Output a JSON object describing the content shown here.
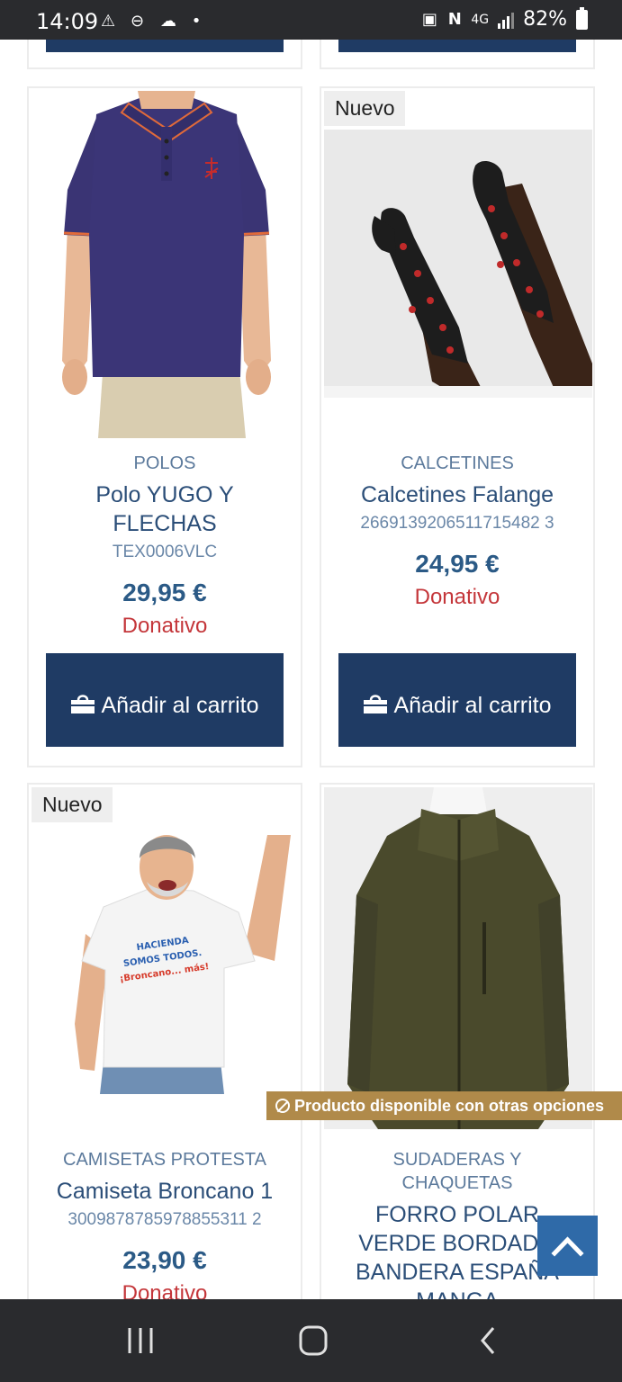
{
  "status_bar": {
    "time": "14:09",
    "left_icons": [
      "alert-icon",
      "do-not-disturb-icon",
      "cloud-icon",
      "dot-icon"
    ],
    "network": "4G",
    "battery": "82%"
  },
  "products": [
    {
      "badge": "",
      "category": "POLOS",
      "title": "Polo YUGO Y FLECHAS",
      "ref": "TEX0006VLC",
      "price": "29,95 €",
      "donativo": "Donativo",
      "button": "Añadir al carrito"
    },
    {
      "badge": "Nuevo",
      "category": "CALCETINES",
      "title": "Calcetines Falange",
      "ref": "2669139206511715482 3",
      "price": "24,95 €",
      "donativo": "Donativo",
      "button": "Añadir al carrito"
    },
    {
      "badge": "Nuevo",
      "category": "CAMISETAS PROTESTA",
      "title": "Camiseta Broncano 1",
      "ref": "3009878785978855311 2",
      "price": "23,90 €",
      "donativo": "Donativo",
      "shirt_text_1": "HACIENDA",
      "shirt_text_2": "SOMOS TODOS.",
      "shirt_text_3": "¡Broncano... más!"
    },
    {
      "category": "SUDADERAS Y CHAQUETAS",
      "title": "FORRO POLAR VERDE BORDADO BANDERA ESPAÑA MANGA",
      "options_banner": "Producto disponible con otras opciones"
    }
  ],
  "colors": {
    "button": "#1f3b64",
    "price": "#2b5a86",
    "donativo": "#c4363a",
    "category": "#5c7a9c",
    "banner": "#b08a4a",
    "scroll_top": "#2f6aa8"
  }
}
